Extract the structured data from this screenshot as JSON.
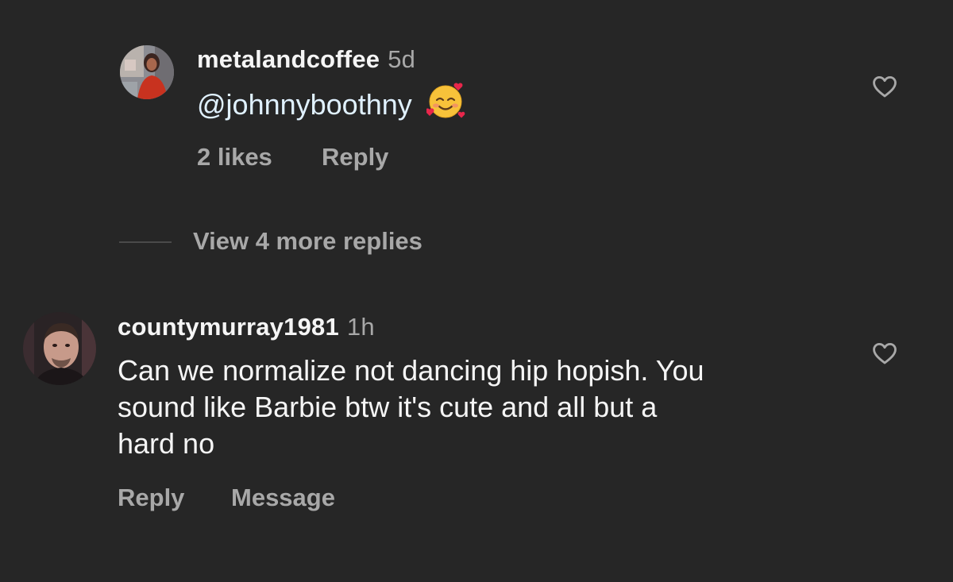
{
  "comments": [
    {
      "username": "metalandcoffee",
      "time": "5d",
      "text": "@johnnyboothny",
      "emoji": "smiling-face-with-hearts",
      "likes_label": "2 likes",
      "reply_label": "Reply"
    },
    {
      "username": "countymurray1981",
      "time": "1h",
      "text_lines": [
        "Can we normalize not dancing hip hopish. You",
        "sound like Barbie btw it's cute and all but a",
        "hard no"
      ],
      "reply_label": "Reply",
      "message_label": "Message"
    }
  ],
  "view_replies_label": "View 4 more replies",
  "icons": {
    "like": "heart-outline-icon"
  },
  "colors": {
    "background": "#262626",
    "primary_text": "#f5f5f5",
    "secondary_text": "#a8a8a8",
    "mention": "#e0f1ff"
  }
}
